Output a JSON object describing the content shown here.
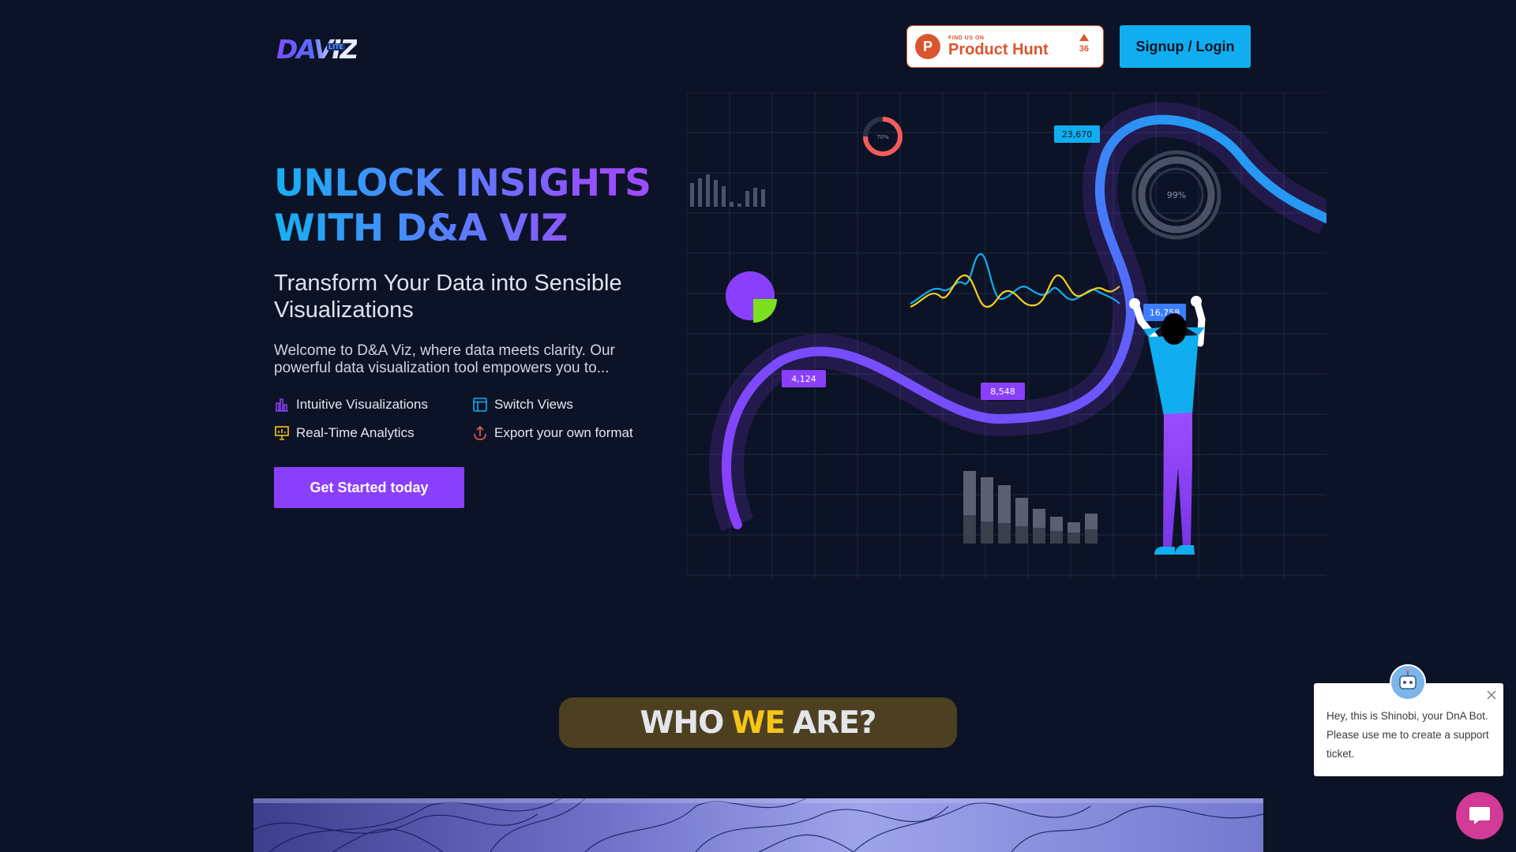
{
  "header": {
    "logo_text": "DAVIZ",
    "logo_badge": "LITE",
    "product_hunt": {
      "small_label": "FIND US ON",
      "big_label": "Product Hunt",
      "votes": "36"
    },
    "signup_label": "Signup / Login"
  },
  "hero": {
    "title": "UNLOCK INSIGHTS WITH D&A VIZ",
    "subtitle": "Transform Your Data into Sensible Visualizations",
    "description": "Welcome to D&A Viz, where data meets clarity. Our powerful data visualization tool empowers you to...",
    "features": [
      {
        "label": "Intuitive Visualizations",
        "icon": "bar-chart-icon",
        "color": "#8a3ffc"
      },
      {
        "label": "Switch Views",
        "icon": "layout-icon",
        "color": "#10aef0"
      },
      {
        "label": "Real-Time Analytics",
        "icon": "presentation-icon",
        "color": "#f5c518"
      },
      {
        "label": "Export your own format",
        "icon": "export-icon",
        "color": "#f25c5c"
      }
    ],
    "cta_label": "Get Started today"
  },
  "illustration": {
    "labels": {
      "top_right": "23,670",
      "mid_right": "16,758",
      "mid": "8,548",
      "left": "4,124",
      "gauge": "99%",
      "small_gauge": "70%"
    }
  },
  "who": {
    "word1": "WHO",
    "word2": "WE",
    "word3": "ARE?"
  },
  "chat": {
    "message": "Hey, this is Shinobi, your DnA Bot. Please use me to create a support ticket."
  },
  "colors": {
    "background": "#0d1326",
    "accent_purple": "#8a3ffc",
    "accent_blue": "#10aef0",
    "accent_yellow": "#f5c518",
    "product_hunt": "#da552f",
    "chat": "#d13a96"
  }
}
